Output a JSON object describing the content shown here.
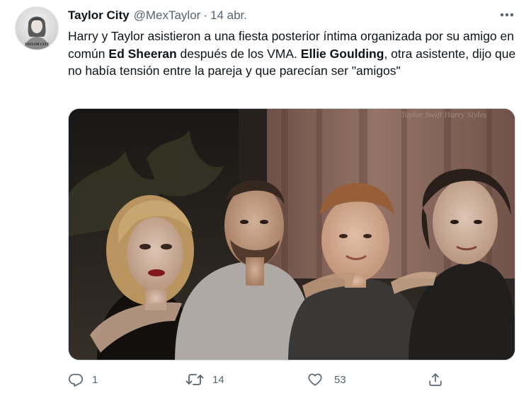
{
  "tweet": {
    "display_name": "Taylor City",
    "handle": "@MexTaylor",
    "separator": "·",
    "date": "14 abr.",
    "avatar_caption": "TAYLOR CITY",
    "text_segments": [
      {
        "text": "Harry y Taylor asistieron a una fiesta posterior íntima organizada por su amigo en común ",
        "bold": false
      },
      {
        "text": "Ed Sheeran",
        "bold": true
      },
      {
        "text": " después de los VMA. ",
        "bold": false
      },
      {
        "text": "Ellie Goulding",
        "bold": true
      },
      {
        "text": ", otra asistente, dijo que no había tensión entre la pareja y que parecían ser \"amigos\"",
        "bold": false
      }
    ],
    "media": {
      "watermark": "Taylor Swift Harry Styles"
    }
  },
  "actions": {
    "reply": {
      "icon": "reply-icon",
      "count": "1"
    },
    "retweet": {
      "icon": "retweet-icon",
      "count": "14"
    },
    "like": {
      "icon": "heart-icon",
      "count": "53"
    },
    "share": {
      "icon": "share-icon"
    }
  },
  "colors": {
    "text_primary": "#0f1419",
    "text_secondary": "#536471",
    "border": "#cfd9de"
  }
}
